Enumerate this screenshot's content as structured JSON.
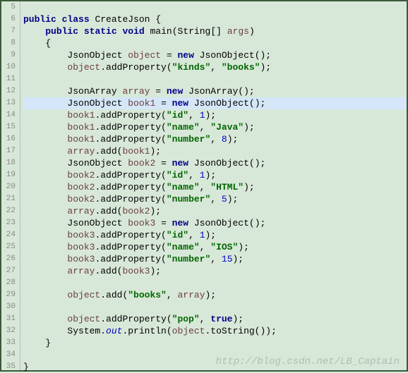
{
  "gutter": {
    "start": 5,
    "end": 35
  },
  "highlight_line": 13,
  "caret_line": 7,
  "watermark": "http://blog.csdn.net/LB_Captain",
  "code_lines": [
    {
      "ln": 5,
      "indent": 0,
      "tokens": []
    },
    {
      "ln": 6,
      "indent": 0,
      "tokens": [
        {
          "t": "kw",
          "v": "public"
        },
        {
          "t": "pl",
          "v": " "
        },
        {
          "t": "kw",
          "v": "class"
        },
        {
          "t": "pl",
          "v": " "
        },
        {
          "t": "cls",
          "v": "CreateJson"
        },
        {
          "t": "pl",
          "v": " {"
        }
      ]
    },
    {
      "ln": 7,
      "indent": 1,
      "tokens": [
        {
          "t": "kw",
          "v": "public"
        },
        {
          "t": "pl",
          "v": " "
        },
        {
          "t": "kw",
          "v": "static"
        },
        {
          "t": "pl",
          "v": " "
        },
        {
          "t": "kw",
          "v": "void"
        },
        {
          "t": "pl",
          "v": " "
        },
        {
          "t": "method",
          "v": "main"
        },
        {
          "t": "pl",
          "v": "(String[] "
        },
        {
          "t": "var",
          "v": "args"
        },
        {
          "t": "pl",
          "v": ")"
        }
      ]
    },
    {
      "ln": 8,
      "indent": 1,
      "tokens": [
        {
          "t": "pl",
          "v": "{"
        }
      ]
    },
    {
      "ln": 9,
      "indent": 2,
      "tokens": [
        {
          "t": "type",
          "v": "JsonObject"
        },
        {
          "t": "pl",
          "v": " "
        },
        {
          "t": "var",
          "v": "object"
        },
        {
          "t": "pl",
          "v": " = "
        },
        {
          "t": "kw",
          "v": "new"
        },
        {
          "t": "pl",
          "v": " JsonObject();"
        }
      ]
    },
    {
      "ln": 10,
      "indent": 2,
      "tokens": [
        {
          "t": "var",
          "v": "object"
        },
        {
          "t": "pl",
          "v": ".addProperty("
        },
        {
          "t": "str",
          "v": "\"kinds\""
        },
        {
          "t": "pl",
          "v": ", "
        },
        {
          "t": "str",
          "v": "\"books\""
        },
        {
          "t": "pl",
          "v": ");"
        }
      ]
    },
    {
      "ln": 11,
      "indent": 2,
      "tokens": []
    },
    {
      "ln": 12,
      "indent": 2,
      "tokens": [
        {
          "t": "type",
          "v": "JsonArray"
        },
        {
          "t": "pl",
          "v": " "
        },
        {
          "t": "var",
          "v": "array"
        },
        {
          "t": "pl",
          "v": " = "
        },
        {
          "t": "kw",
          "v": "new"
        },
        {
          "t": "pl",
          "v": " JsonArray();"
        }
      ]
    },
    {
      "ln": 13,
      "indent": 2,
      "tokens": [
        {
          "t": "type",
          "v": "JsonObject"
        },
        {
          "t": "pl",
          "v": " "
        },
        {
          "t": "var",
          "v": "book1"
        },
        {
          "t": "pl",
          "v": " = "
        },
        {
          "t": "kw",
          "v": "new"
        },
        {
          "t": "pl",
          "v": " JsonObject();"
        }
      ]
    },
    {
      "ln": 14,
      "indent": 2,
      "tokens": [
        {
          "t": "var",
          "v": "book1"
        },
        {
          "t": "pl",
          "v": ".addProperty("
        },
        {
          "t": "str",
          "v": "\"id\""
        },
        {
          "t": "pl",
          "v": ", "
        },
        {
          "t": "num",
          "v": "1"
        },
        {
          "t": "pl",
          "v": ");"
        }
      ]
    },
    {
      "ln": 15,
      "indent": 2,
      "tokens": [
        {
          "t": "var",
          "v": "book1"
        },
        {
          "t": "pl",
          "v": ".addProperty("
        },
        {
          "t": "str",
          "v": "\"name\""
        },
        {
          "t": "pl",
          "v": ", "
        },
        {
          "t": "str",
          "v": "\"Java\""
        },
        {
          "t": "pl",
          "v": ");"
        }
      ]
    },
    {
      "ln": 16,
      "indent": 2,
      "tokens": [
        {
          "t": "var",
          "v": "book1"
        },
        {
          "t": "pl",
          "v": ".addProperty("
        },
        {
          "t": "str",
          "v": "\"number\""
        },
        {
          "t": "pl",
          "v": ", "
        },
        {
          "t": "num",
          "v": "8"
        },
        {
          "t": "pl",
          "v": ");"
        }
      ]
    },
    {
      "ln": 17,
      "indent": 2,
      "tokens": [
        {
          "t": "var",
          "v": "array"
        },
        {
          "t": "pl",
          "v": ".add("
        },
        {
          "t": "var",
          "v": "book1"
        },
        {
          "t": "pl",
          "v": ");"
        }
      ]
    },
    {
      "ln": 18,
      "indent": 2,
      "tokens": [
        {
          "t": "type",
          "v": "JsonObject"
        },
        {
          "t": "pl",
          "v": " "
        },
        {
          "t": "var",
          "v": "book2"
        },
        {
          "t": "pl",
          "v": " = "
        },
        {
          "t": "kw",
          "v": "new"
        },
        {
          "t": "pl",
          "v": " JsonObject();"
        }
      ]
    },
    {
      "ln": 19,
      "indent": 2,
      "tokens": [
        {
          "t": "var",
          "v": "book2"
        },
        {
          "t": "pl",
          "v": ".addProperty("
        },
        {
          "t": "str",
          "v": "\"id\""
        },
        {
          "t": "pl",
          "v": ", "
        },
        {
          "t": "num",
          "v": "1"
        },
        {
          "t": "pl",
          "v": ");"
        }
      ]
    },
    {
      "ln": 20,
      "indent": 2,
      "tokens": [
        {
          "t": "var",
          "v": "book2"
        },
        {
          "t": "pl",
          "v": ".addProperty("
        },
        {
          "t": "str",
          "v": "\"name\""
        },
        {
          "t": "pl",
          "v": ", "
        },
        {
          "t": "str",
          "v": "\"HTML\""
        },
        {
          "t": "pl",
          "v": ");"
        }
      ]
    },
    {
      "ln": 21,
      "indent": 2,
      "tokens": [
        {
          "t": "var",
          "v": "book2"
        },
        {
          "t": "pl",
          "v": ".addProperty("
        },
        {
          "t": "str",
          "v": "\"number\""
        },
        {
          "t": "pl",
          "v": ", "
        },
        {
          "t": "num",
          "v": "5"
        },
        {
          "t": "pl",
          "v": ");"
        }
      ]
    },
    {
      "ln": 22,
      "indent": 2,
      "tokens": [
        {
          "t": "var",
          "v": "array"
        },
        {
          "t": "pl",
          "v": ".add("
        },
        {
          "t": "var",
          "v": "book2"
        },
        {
          "t": "pl",
          "v": ");"
        }
      ]
    },
    {
      "ln": 23,
      "indent": 2,
      "tokens": [
        {
          "t": "type",
          "v": "JsonObject"
        },
        {
          "t": "pl",
          "v": " "
        },
        {
          "t": "var",
          "v": "book3"
        },
        {
          "t": "pl",
          "v": " = "
        },
        {
          "t": "kw",
          "v": "new"
        },
        {
          "t": "pl",
          "v": " JsonObject();"
        }
      ]
    },
    {
      "ln": 24,
      "indent": 2,
      "tokens": [
        {
          "t": "var",
          "v": "book3"
        },
        {
          "t": "pl",
          "v": ".addProperty("
        },
        {
          "t": "str",
          "v": "\"id\""
        },
        {
          "t": "pl",
          "v": ", "
        },
        {
          "t": "num",
          "v": "1"
        },
        {
          "t": "pl",
          "v": ");"
        }
      ]
    },
    {
      "ln": 25,
      "indent": 2,
      "tokens": [
        {
          "t": "var",
          "v": "book3"
        },
        {
          "t": "pl",
          "v": ".addProperty("
        },
        {
          "t": "str",
          "v": "\"name\""
        },
        {
          "t": "pl",
          "v": ", "
        },
        {
          "t": "str",
          "v": "\"IOS\""
        },
        {
          "t": "pl",
          "v": ");"
        }
      ]
    },
    {
      "ln": 26,
      "indent": 2,
      "tokens": [
        {
          "t": "var",
          "v": "book3"
        },
        {
          "t": "pl",
          "v": ".addProperty("
        },
        {
          "t": "str",
          "v": "\"number\""
        },
        {
          "t": "pl",
          "v": ", "
        },
        {
          "t": "num",
          "v": "15"
        },
        {
          "t": "pl",
          "v": ");"
        }
      ]
    },
    {
      "ln": 27,
      "indent": 2,
      "tokens": [
        {
          "t": "var",
          "v": "array"
        },
        {
          "t": "pl",
          "v": ".add("
        },
        {
          "t": "var",
          "v": "book3"
        },
        {
          "t": "pl",
          "v": ");"
        }
      ]
    },
    {
      "ln": 28,
      "indent": 2,
      "tokens": []
    },
    {
      "ln": 29,
      "indent": 2,
      "tokens": [
        {
          "t": "var",
          "v": "object"
        },
        {
          "t": "pl",
          "v": ".add("
        },
        {
          "t": "str",
          "v": "\"books\""
        },
        {
          "t": "pl",
          "v": ", "
        },
        {
          "t": "var",
          "v": "array"
        },
        {
          "t": "pl",
          "v": ");"
        }
      ]
    },
    {
      "ln": 30,
      "indent": 2,
      "tokens": []
    },
    {
      "ln": 31,
      "indent": 2,
      "tokens": [
        {
          "t": "var",
          "v": "object"
        },
        {
          "t": "pl",
          "v": ".addProperty("
        },
        {
          "t": "str",
          "v": "\"pop\""
        },
        {
          "t": "pl",
          "v": ", "
        },
        {
          "t": "bool",
          "v": "true"
        },
        {
          "t": "pl",
          "v": ");"
        }
      ]
    },
    {
      "ln": 32,
      "indent": 2,
      "tokens": [
        {
          "t": "pl",
          "v": "System."
        },
        {
          "t": "static-field",
          "v": "out"
        },
        {
          "t": "pl",
          "v": ".println("
        },
        {
          "t": "var",
          "v": "object"
        },
        {
          "t": "pl",
          "v": ".toString());"
        }
      ]
    },
    {
      "ln": 33,
      "indent": 1,
      "tokens": [
        {
          "t": "pl",
          "v": "}"
        }
      ]
    },
    {
      "ln": 34,
      "indent": 0,
      "tokens": []
    },
    {
      "ln": 35,
      "indent": 0,
      "tokens": [
        {
          "t": "pl",
          "v": "}"
        }
      ]
    }
  ]
}
